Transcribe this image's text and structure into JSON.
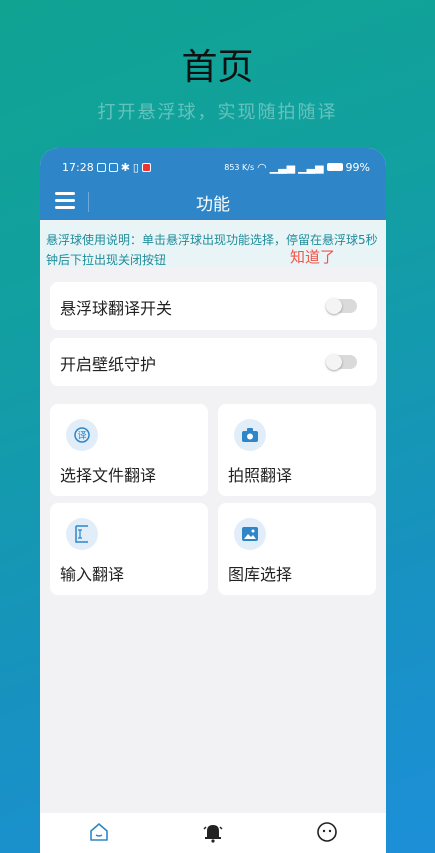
{
  "header": {
    "title": "首页",
    "subtitle": "打开悬浮球，实现随拍随译"
  },
  "status_bar": {
    "time": "17:28",
    "net_speed": "853 K/s",
    "battery": "99%"
  },
  "app_bar": {
    "title": "功能"
  },
  "notice": {
    "text": "悬浮球使用说明：单击悬浮球出现功能选择，停留在悬浮球5秒钟后下拉出现关闭按钮",
    "dismiss_label": "知道了"
  },
  "settings": [
    {
      "label": "悬浮球翻译开关",
      "enabled": false
    },
    {
      "label": "开启壁纸守护",
      "enabled": false
    }
  ],
  "features": [
    {
      "label": "选择文件翻译",
      "icon": "translate-icon"
    },
    {
      "label": "拍照翻译",
      "icon": "camera-icon"
    },
    {
      "label": "输入翻译",
      "icon": "text-input-icon"
    },
    {
      "label": "图库选择",
      "icon": "gallery-icon"
    }
  ],
  "bottom_nav": [
    {
      "icon": "home-icon",
      "active": true
    },
    {
      "icon": "bell-icon",
      "active": false
    },
    {
      "icon": "face-icon",
      "active": false
    }
  ],
  "colors": {
    "accent": "#2e86c9",
    "notice_text": "#1f8d9a",
    "dismiss": "#f0554a"
  }
}
